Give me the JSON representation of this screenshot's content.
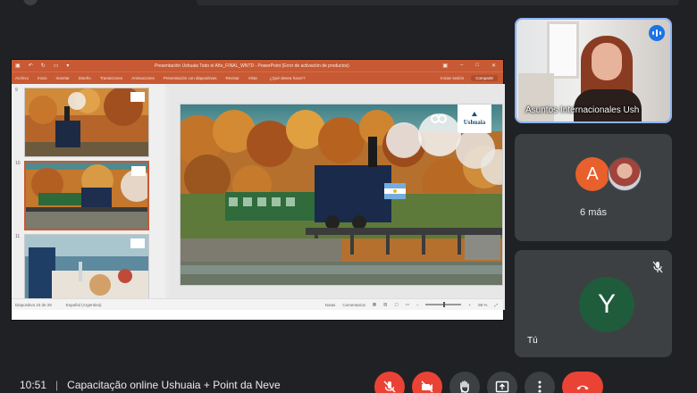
{
  "presentation": {
    "window_title": "Presentación Ushuaia Todo el Año_FINAL_WNTD - PowerPoint (Error de activación de productos)",
    "ribbon_tabs": [
      "Archivo",
      "Inicio",
      "Insertar",
      "Diseño",
      "Transiciones",
      "Animaciones",
      "Presentación con diapositivas",
      "Revisar",
      "Vista"
    ],
    "tell_me": "¿Qué desea hacer?",
    "sign_in": "Iniciar sesión",
    "share": "Compartir",
    "slide_numbers": [
      "9",
      "10",
      "11"
    ],
    "status_left": "Diapositiva 10 de 29",
    "status_lang": "Español (Argentina)",
    "status_notes": "Notas",
    "status_comments": "Comentarios",
    "zoom": "99 %",
    "slide_logo_text": "Ushuaia",
    "slide_logo_sub": "FIN DEL MUNDO"
  },
  "participants": {
    "speaker_name": "Asuntos Internacionales Ush",
    "others_initial": "A",
    "others_more": "6 más",
    "you_initial": "Y",
    "you_label": "Tú"
  },
  "meeting": {
    "time": "10:51",
    "separator": "|",
    "title": "Capacitação online Ushuaia + Point da Neve"
  },
  "colors": {
    "accent_red": "#ea4335",
    "speaker_border": "#8ab4f8",
    "ppt_orange": "#c75a34"
  },
  "icons": [
    "mic-off-icon",
    "camera-off-icon",
    "raise-hand-icon",
    "present-icon",
    "more-icon",
    "hangup-icon"
  ]
}
